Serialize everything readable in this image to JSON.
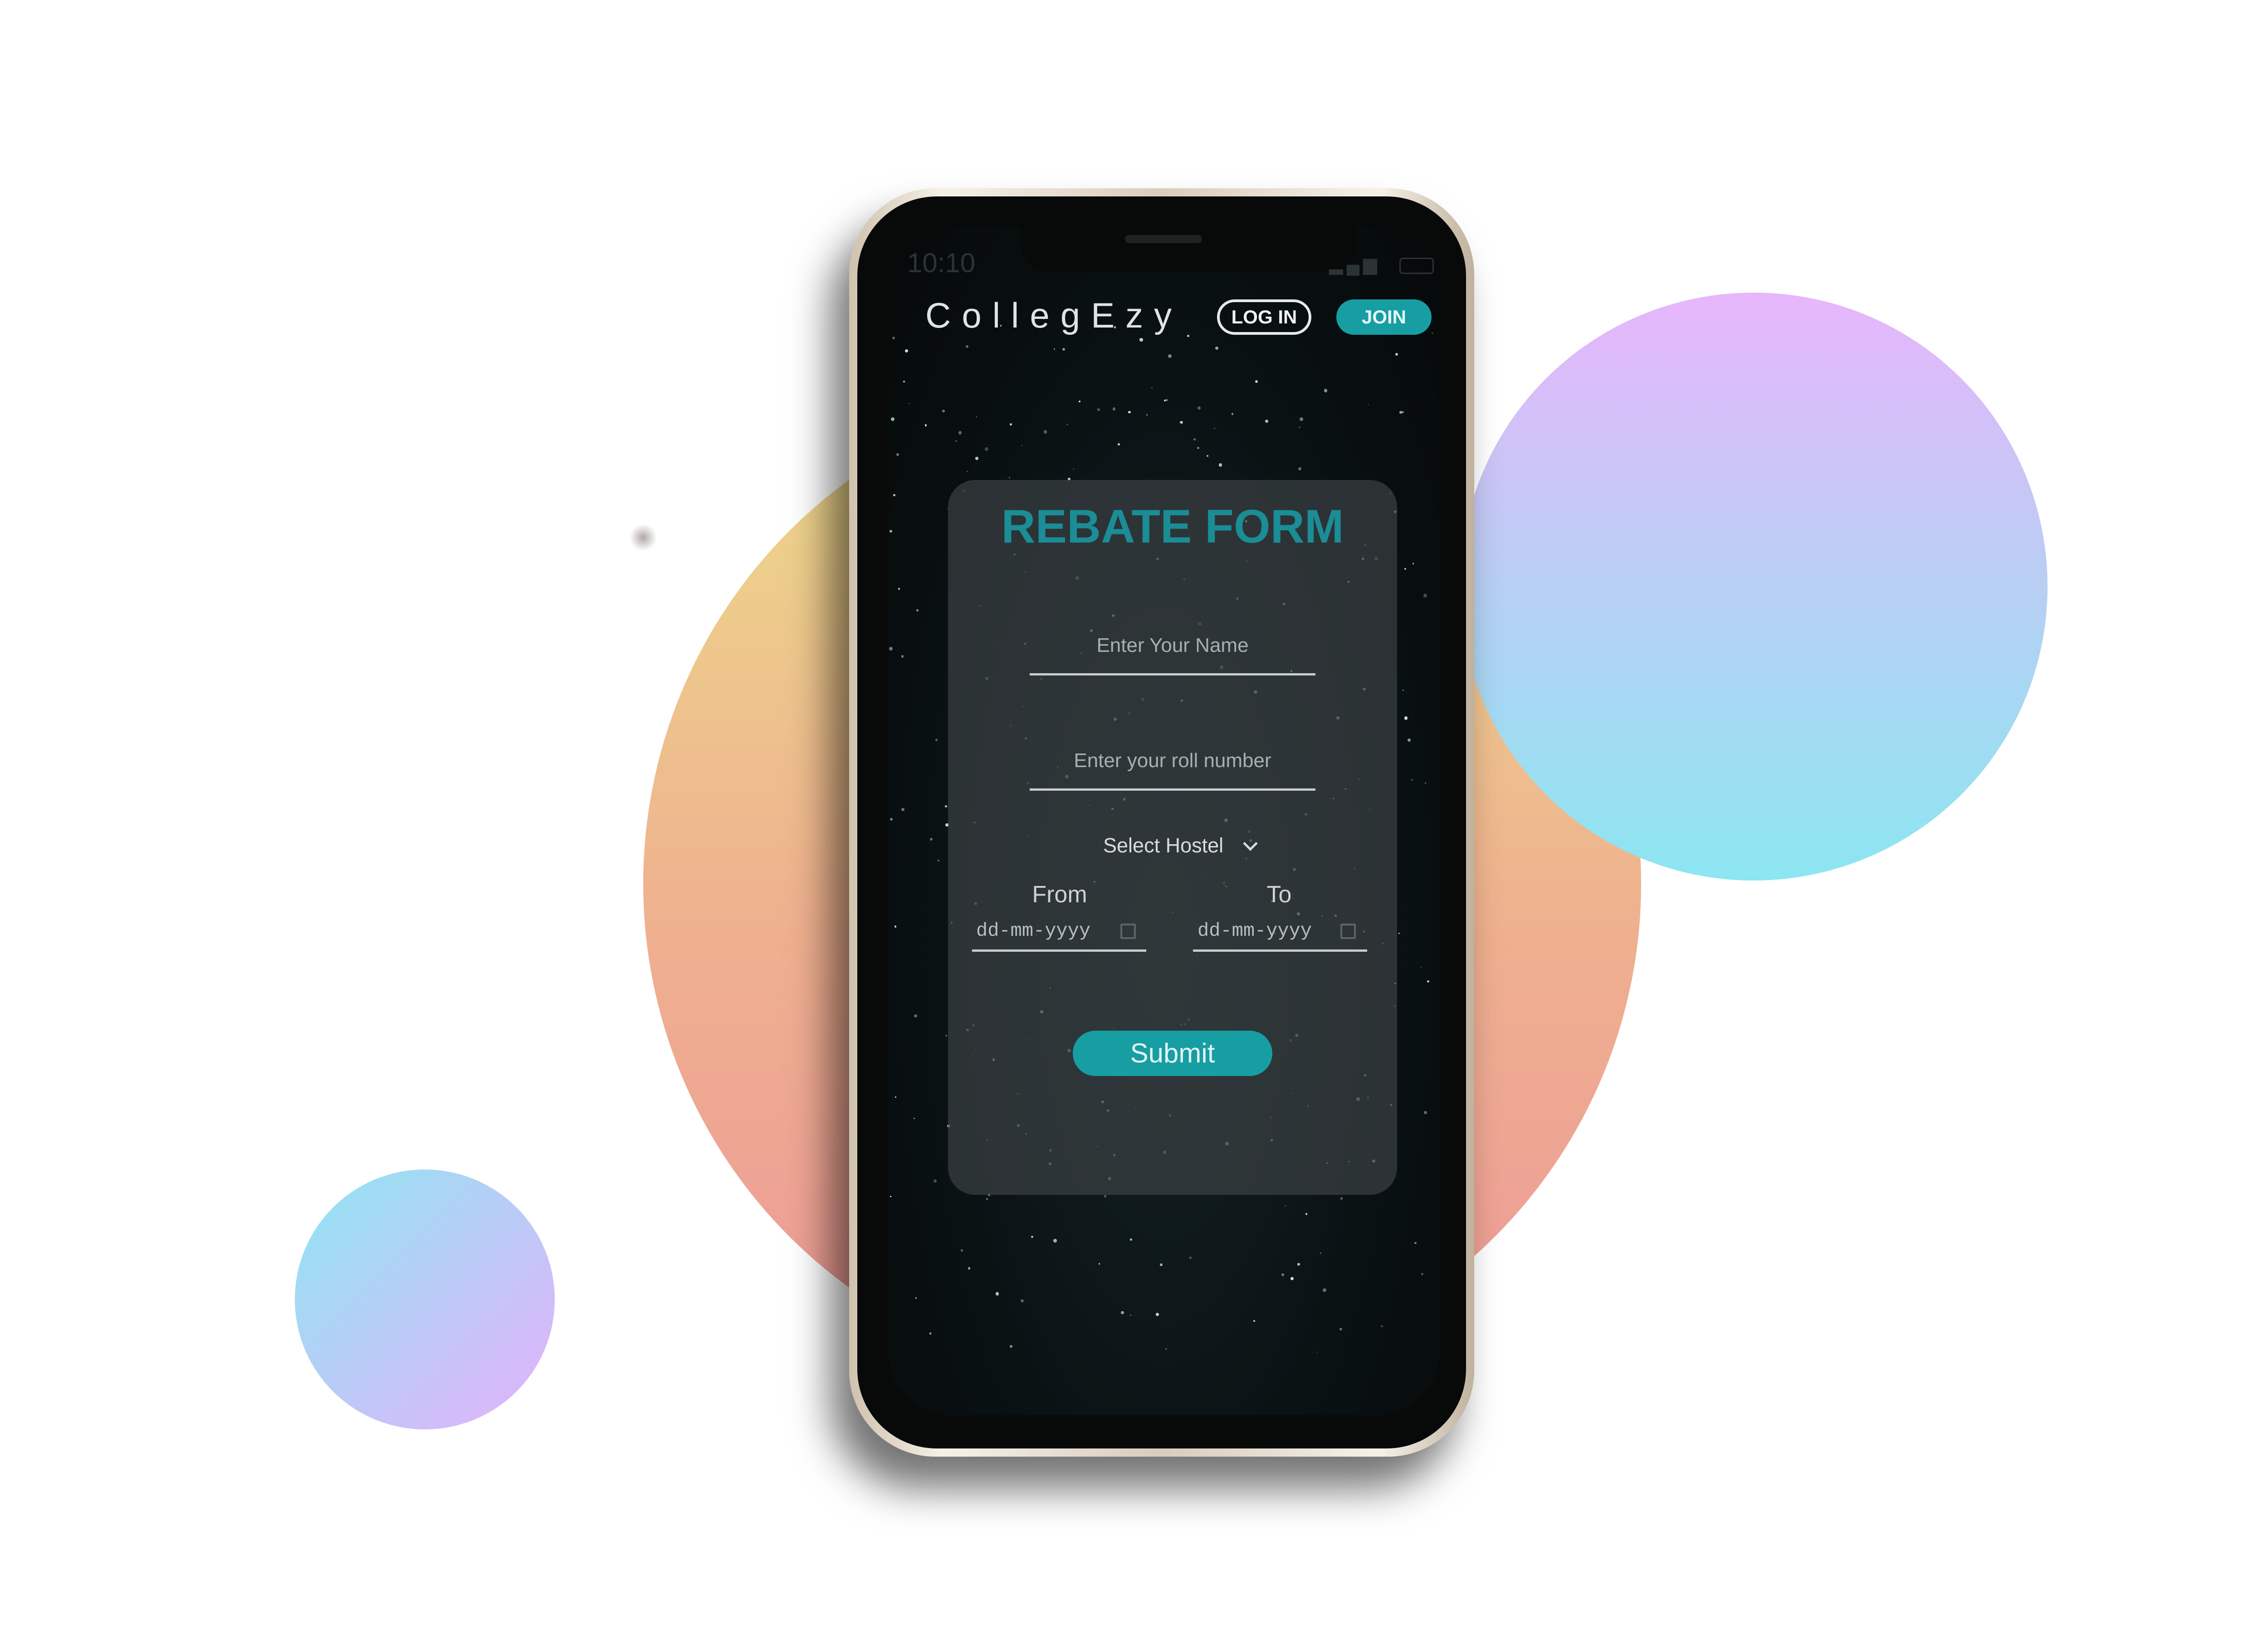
{
  "app": {
    "brand": "CollegEzy"
  },
  "status_bar": {
    "time": "10:10",
    "icons": [
      "signal-icon",
      "wifi-icon",
      "battery-icon"
    ]
  },
  "header": {
    "login_label": "LOG IN",
    "join_label": "JOIN"
  },
  "form": {
    "title": "REBATE FORM",
    "name_placeholder": "Enter Your Name",
    "roll_placeholder": "Enter your roll number",
    "hostel_select": "Select Hostel",
    "from_label": "From",
    "to_label": "To",
    "from_placeholder": "dd-mm-yyyy",
    "to_placeholder": "dd-mm-yyyy",
    "submit_label": "Submit"
  },
  "colors": {
    "accent": "#169ea3",
    "title": "#1a8d96",
    "screen_bg": "#0a1214"
  }
}
